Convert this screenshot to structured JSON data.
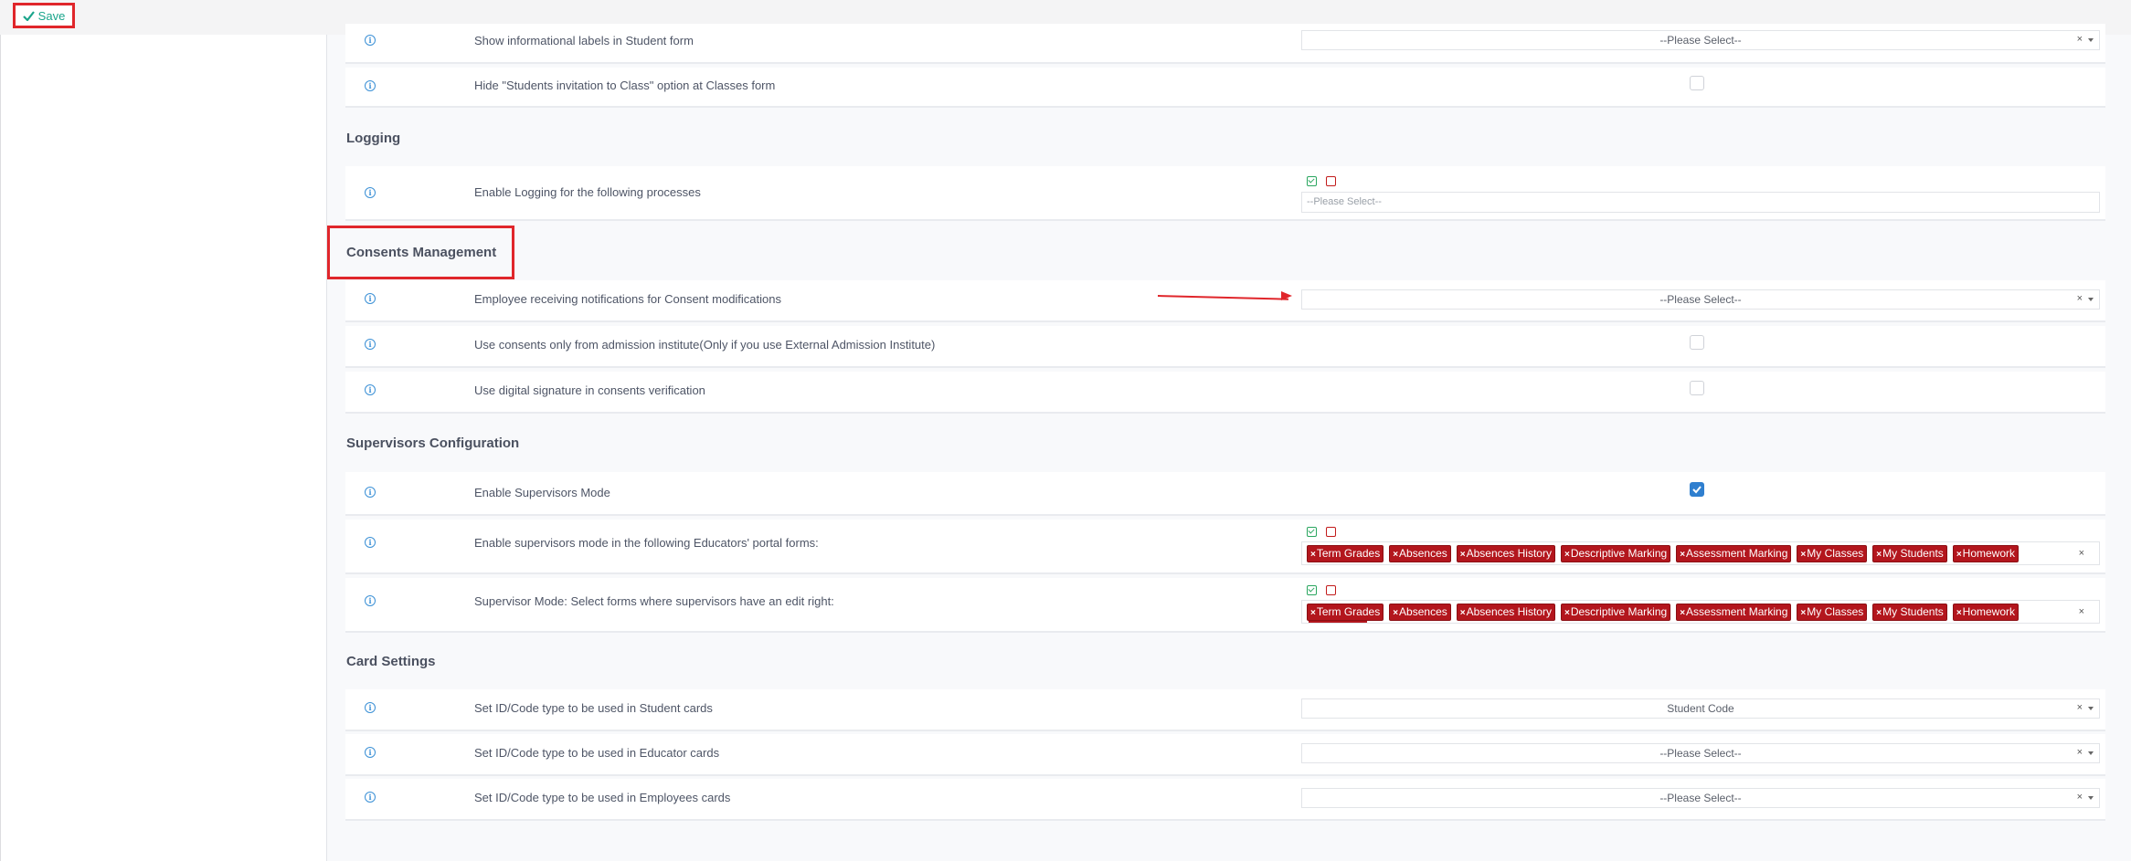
{
  "toolbar": {
    "save_label": "Save"
  },
  "rows_top": [
    {
      "label": "Show informational labels in Student form",
      "select": "--Please Select--"
    },
    {
      "label": "Hide \"Students invitation to Class\" option at Classes form"
    }
  ],
  "logging": {
    "title": "Logging",
    "row_label": "Enable Logging for the following processes",
    "placeholder": "--Please Select--"
  },
  "consents": {
    "title": "Consents Management",
    "rows": [
      {
        "label": "Employee receiving notifications for Consent modifications",
        "select": "--Please Select--"
      },
      {
        "label": "Use consents only from admission institute(Only if you use External Admission Institute)"
      },
      {
        "label": "Use digital signature in consents verification"
      }
    ]
  },
  "supervisors": {
    "title": "Supervisors Configuration",
    "rows": [
      {
        "label": "Enable Supervisors Mode",
        "checked": true
      },
      {
        "label": "Enable supervisors mode in the following Educators' portal forms:"
      },
      {
        "label": "Supervisor Mode: Select forms where supervisors have an edit right:"
      }
    ],
    "tags": [
      "Term Grades",
      "Absences",
      "Absences History",
      "Descriptive Marking",
      "Assessment Marking",
      "My Classes",
      "My Students",
      "Homework"
    ]
  },
  "cards": {
    "title": "Card Settings",
    "rows": [
      {
        "label": "Set ID/Code type to be used in Student cards",
        "select": "Student Code"
      },
      {
        "label": "Set ID/Code type to be used in Educator cards",
        "select": "--Please Select--"
      },
      {
        "label": "Set ID/Code type to be used in Employees cards",
        "select": "--Please Select--"
      }
    ]
  },
  "glyphs": {
    "clear": "×",
    "tag_remove": "×",
    "info": "i"
  },
  "colors": {
    "accent_green": "#1aa58b",
    "tag_red": "#b3161d",
    "highlight_red": "#e0262b",
    "checkbox_blue": "#2f7fcf"
  }
}
